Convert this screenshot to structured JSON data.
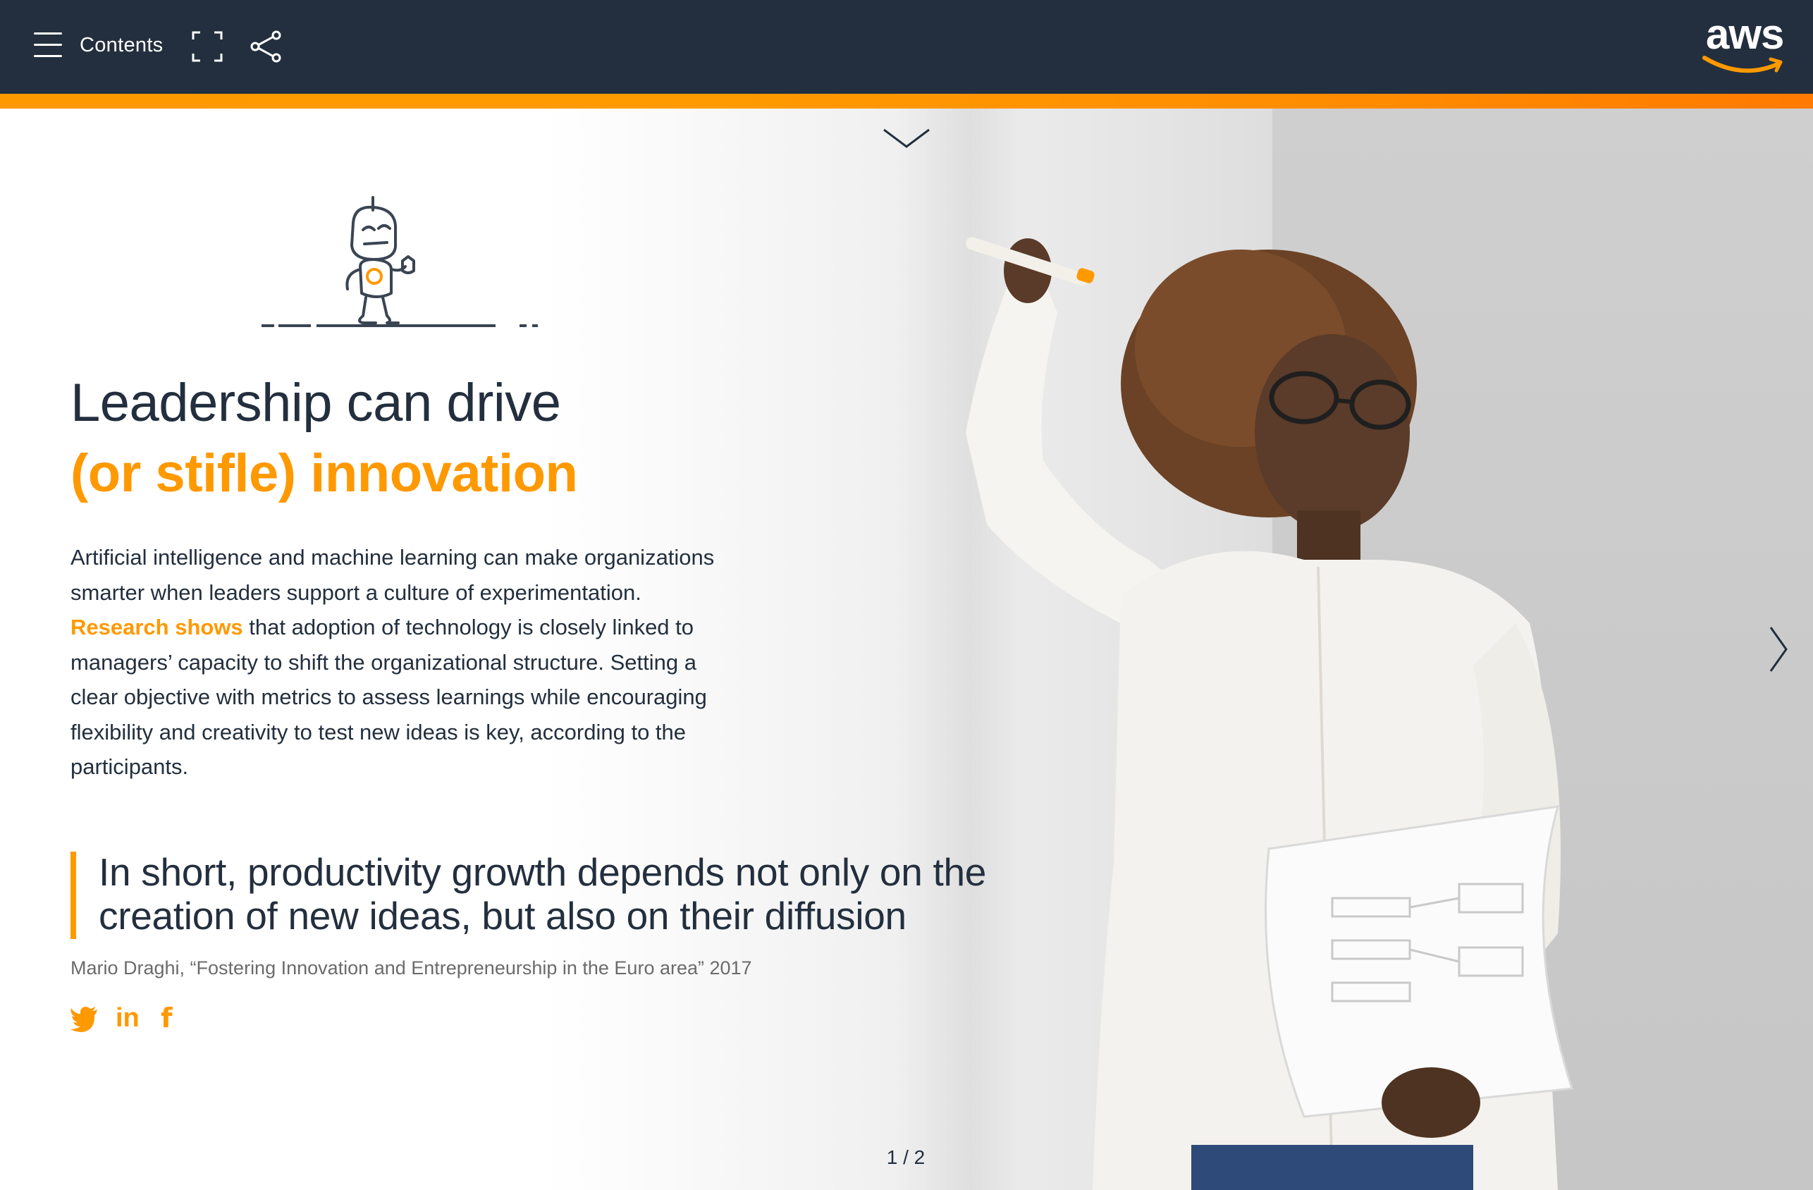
{
  "header": {
    "contents_label": "Contents",
    "brand": "aws"
  },
  "main": {
    "headline_line1": "Leadership can drive",
    "headline_line2": "(or stifle) innovation",
    "body_before": "Artificial intelligence and machine learning can make organizations smarter when leaders support a culture of experimentation. ",
    "body_link": "Research shows",
    "body_after": " that adoption of technology is closely linked to managers’ capacity to shift the organizational structure. Setting a clear objective with metrics to assess learnings while encouraging flexibility and creativity to test new ideas is key, according to the participants.",
    "quote": "In short, productivity growth depends not only on the creation of new ideas, but also on their diffusion",
    "quote_cite": "Mario Draghi, “Fostering Innovation and Entrepreneurship in the Euro area” 2017",
    "social": {
      "linkedin_label": "in",
      "facebook_label": "f"
    }
  },
  "pagination": {
    "indicator": "1 / 2"
  },
  "icons": {
    "menu": "hamburger-menu-icon",
    "fullscreen": "fullscreen-icon",
    "share": "share-icon",
    "down": "chevron-down-icon",
    "next": "chevron-right-icon",
    "twitter": "twitter-icon",
    "linkedin": "linkedin-icon",
    "facebook": "facebook-icon"
  },
  "colors": {
    "header_bg": "#232f3e",
    "accent": "#ff9900",
    "text": "#232f3e",
    "cite": "#6b6b6b"
  }
}
